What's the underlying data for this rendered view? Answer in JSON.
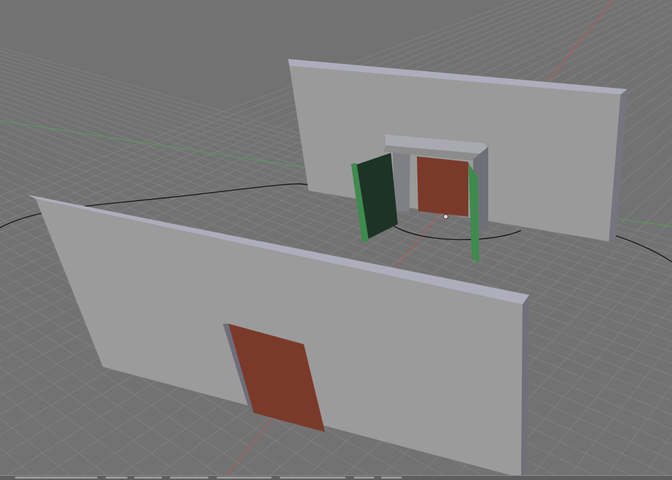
{
  "viewport": {
    "kind": "3d-view",
    "background_color": "#727272",
    "grid_color": "#808080",
    "x_axis_color": "#b45a5a",
    "y_axis_color": "#5a9a5a"
  },
  "scene": {
    "objects": [
      {
        "name": "front-wall",
        "color": "#9b9b9b"
      },
      {
        "name": "back-wall",
        "color": "#9a9a9a"
      },
      {
        "name": "front-door",
        "color": "#7a3a2a"
      },
      {
        "name": "door-frame",
        "color": "#8f8f8f"
      },
      {
        "name": "back-door",
        "color": "#7a3a2a"
      },
      {
        "name": "left-shutter",
        "color": "#1c3326"
      },
      {
        "name": "right-shutter",
        "color": "#3f8a4f"
      },
      {
        "name": "camera-path",
        "color": "#000000"
      },
      {
        "name": "object-origin",
        "color": "#f0c8d0"
      }
    ]
  }
}
